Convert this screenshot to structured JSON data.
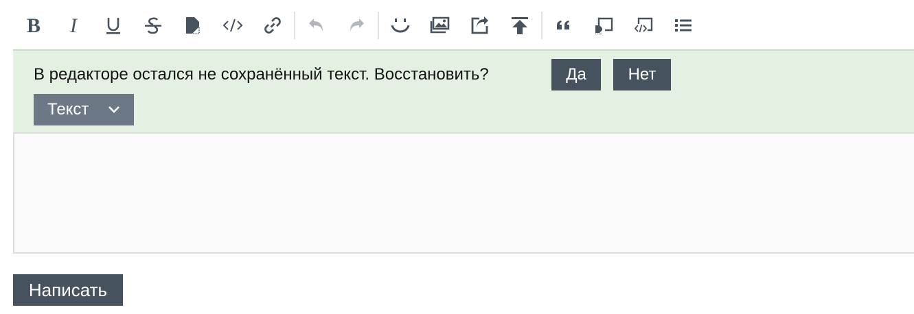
{
  "toolbar": {
    "icon_color": "#47525f",
    "disabled_color": "#b3b7bc",
    "buttons": [
      {
        "name": "bold-icon"
      },
      {
        "name": "italic-icon"
      },
      {
        "name": "underline-icon"
      },
      {
        "name": "strikethrough-icon"
      },
      {
        "name": "spoiler-icon"
      },
      {
        "name": "code-icon"
      },
      {
        "name": "link-icon"
      },
      {
        "name": "undo-icon",
        "disabled": true
      },
      {
        "name": "redo-icon",
        "disabled": true
      },
      {
        "name": "smiley-icon"
      },
      {
        "name": "image-icon"
      },
      {
        "name": "share-icon"
      },
      {
        "name": "upload-icon"
      },
      {
        "name": "quote-icon"
      },
      {
        "name": "spoiler-block-icon"
      },
      {
        "name": "code-block-icon"
      },
      {
        "name": "list-icon"
      }
    ]
  },
  "notice": {
    "text": "В редакторе остался не сохранённый текст. Восстановить?",
    "yes_label": "Да",
    "no_label": "Нет",
    "background": "#e4f0e2"
  },
  "format_select": {
    "selected": "Текст"
  },
  "editor": {
    "value": ""
  },
  "submit": {
    "label": "Написать"
  },
  "colors": {
    "button_dark": "#47525f",
    "select_bg": "#6d7886"
  }
}
